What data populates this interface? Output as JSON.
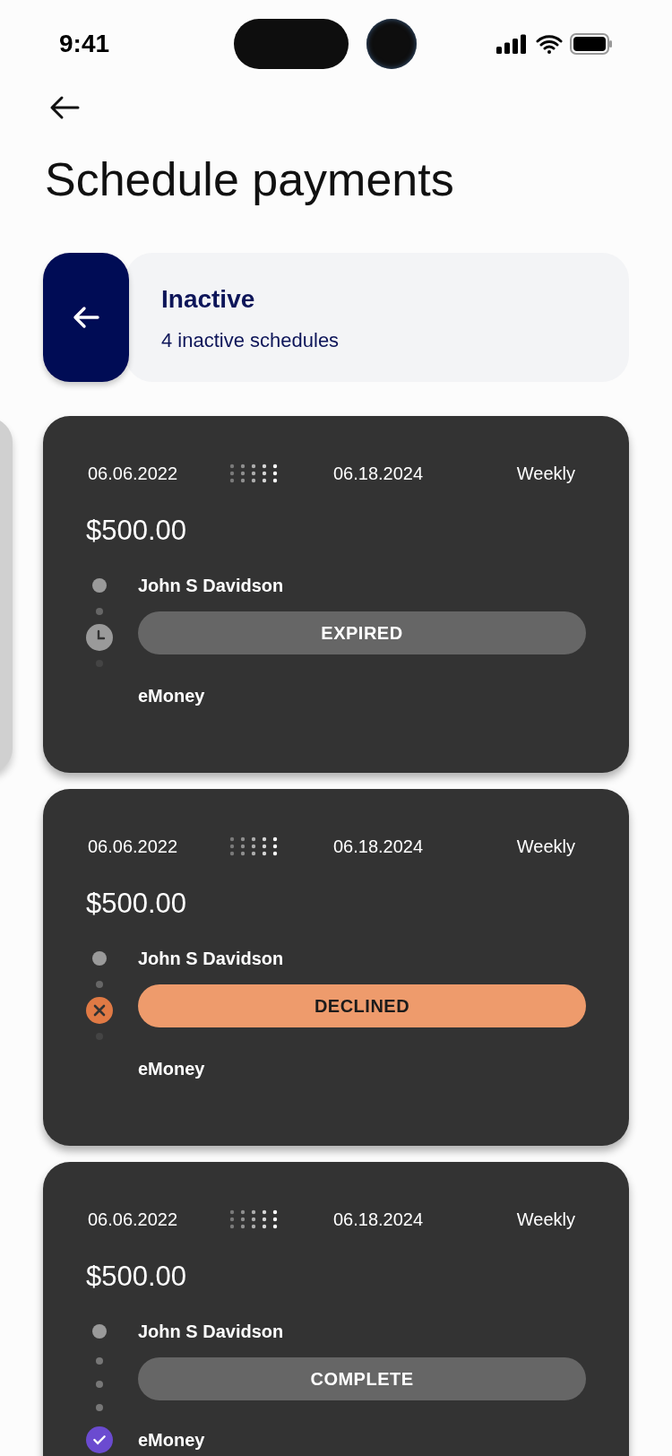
{
  "status_bar": {
    "time": "9:41"
  },
  "title": "Schedule payments",
  "filter": {
    "title": "Inactive",
    "subtitle": "4 inactive schedules"
  },
  "schedules": [
    {
      "start": "06.06.2022",
      "end": "06.18.2024",
      "frequency": "Weekly",
      "amount": "$500.00",
      "payee": "John S Davidson",
      "status": "EXPIRED",
      "kind": "expired",
      "source": "eMoney"
    },
    {
      "start": "06.06.2022",
      "end": "06.18.2024",
      "frequency": "Weekly",
      "amount": "$500.00",
      "payee": "John S Davidson",
      "status": "DECLINED",
      "kind": "declined",
      "source": "eMoney"
    },
    {
      "start": "06.06.2022",
      "end": "06.18.2024",
      "frequency": "Weekly",
      "amount": "$500.00",
      "payee": "John S Davidson",
      "status": "COMPLETE",
      "kind": "complete",
      "source": "eMoney"
    }
  ]
}
